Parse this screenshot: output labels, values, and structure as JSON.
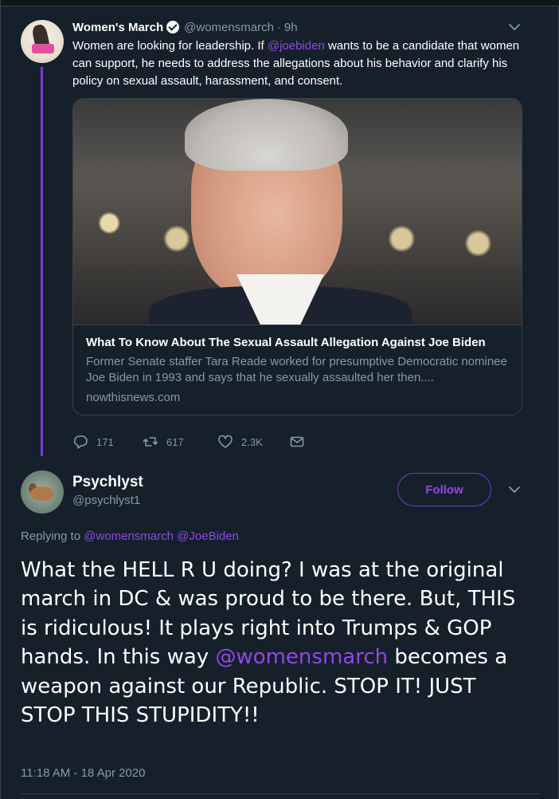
{
  "parent_tweet": {
    "name": "Women's March",
    "handle": "@womensmarch",
    "separator": "·",
    "time": "9h",
    "text_before": "Women are looking for leadership. If ",
    "mention": "@joebiden",
    "text_after": " wants to be a candidate that women can support, he needs to address the allegations about his behavior and clarify his policy on sexual assault, harassment, and consent.",
    "card": {
      "title": "What To Know About The Sexual Assault Allegation Against Joe Biden",
      "description": "Former Senate staffer Tara Reade worked for presumptive Democratic nominee Joe Biden in 1993 and says that he sexually assaulted her then....",
      "domain": "nowthisnews.com"
    },
    "actions": {
      "replies": "171",
      "retweets": "617",
      "likes": "2.3K"
    }
  },
  "reply_tweet": {
    "name": "Psychlyst",
    "handle": "@psychlyst1",
    "follow_label": "Follow",
    "replying_to_label": "Replying to",
    "replying_to_1": "@womensmarch",
    "replying_to_2": "@JoeBiden",
    "text_before": "What the HELL R U doing? I was at the original march in DC & was proud to be there. But, THIS is ridiculous! It plays right into Trumps & GOP hands. In this way ",
    "mention": "@womensmarch",
    "text_after": " becomes a weapon against our Republic. STOP IT! JUST STOP THIS STUPIDITY!!",
    "timestamp": "11:18 AM - 18 Apr 2020"
  },
  "colors": {
    "background": "#15202b",
    "accent": "#9147e8",
    "secondary_text": "#8899a6",
    "border": "#38444d"
  }
}
